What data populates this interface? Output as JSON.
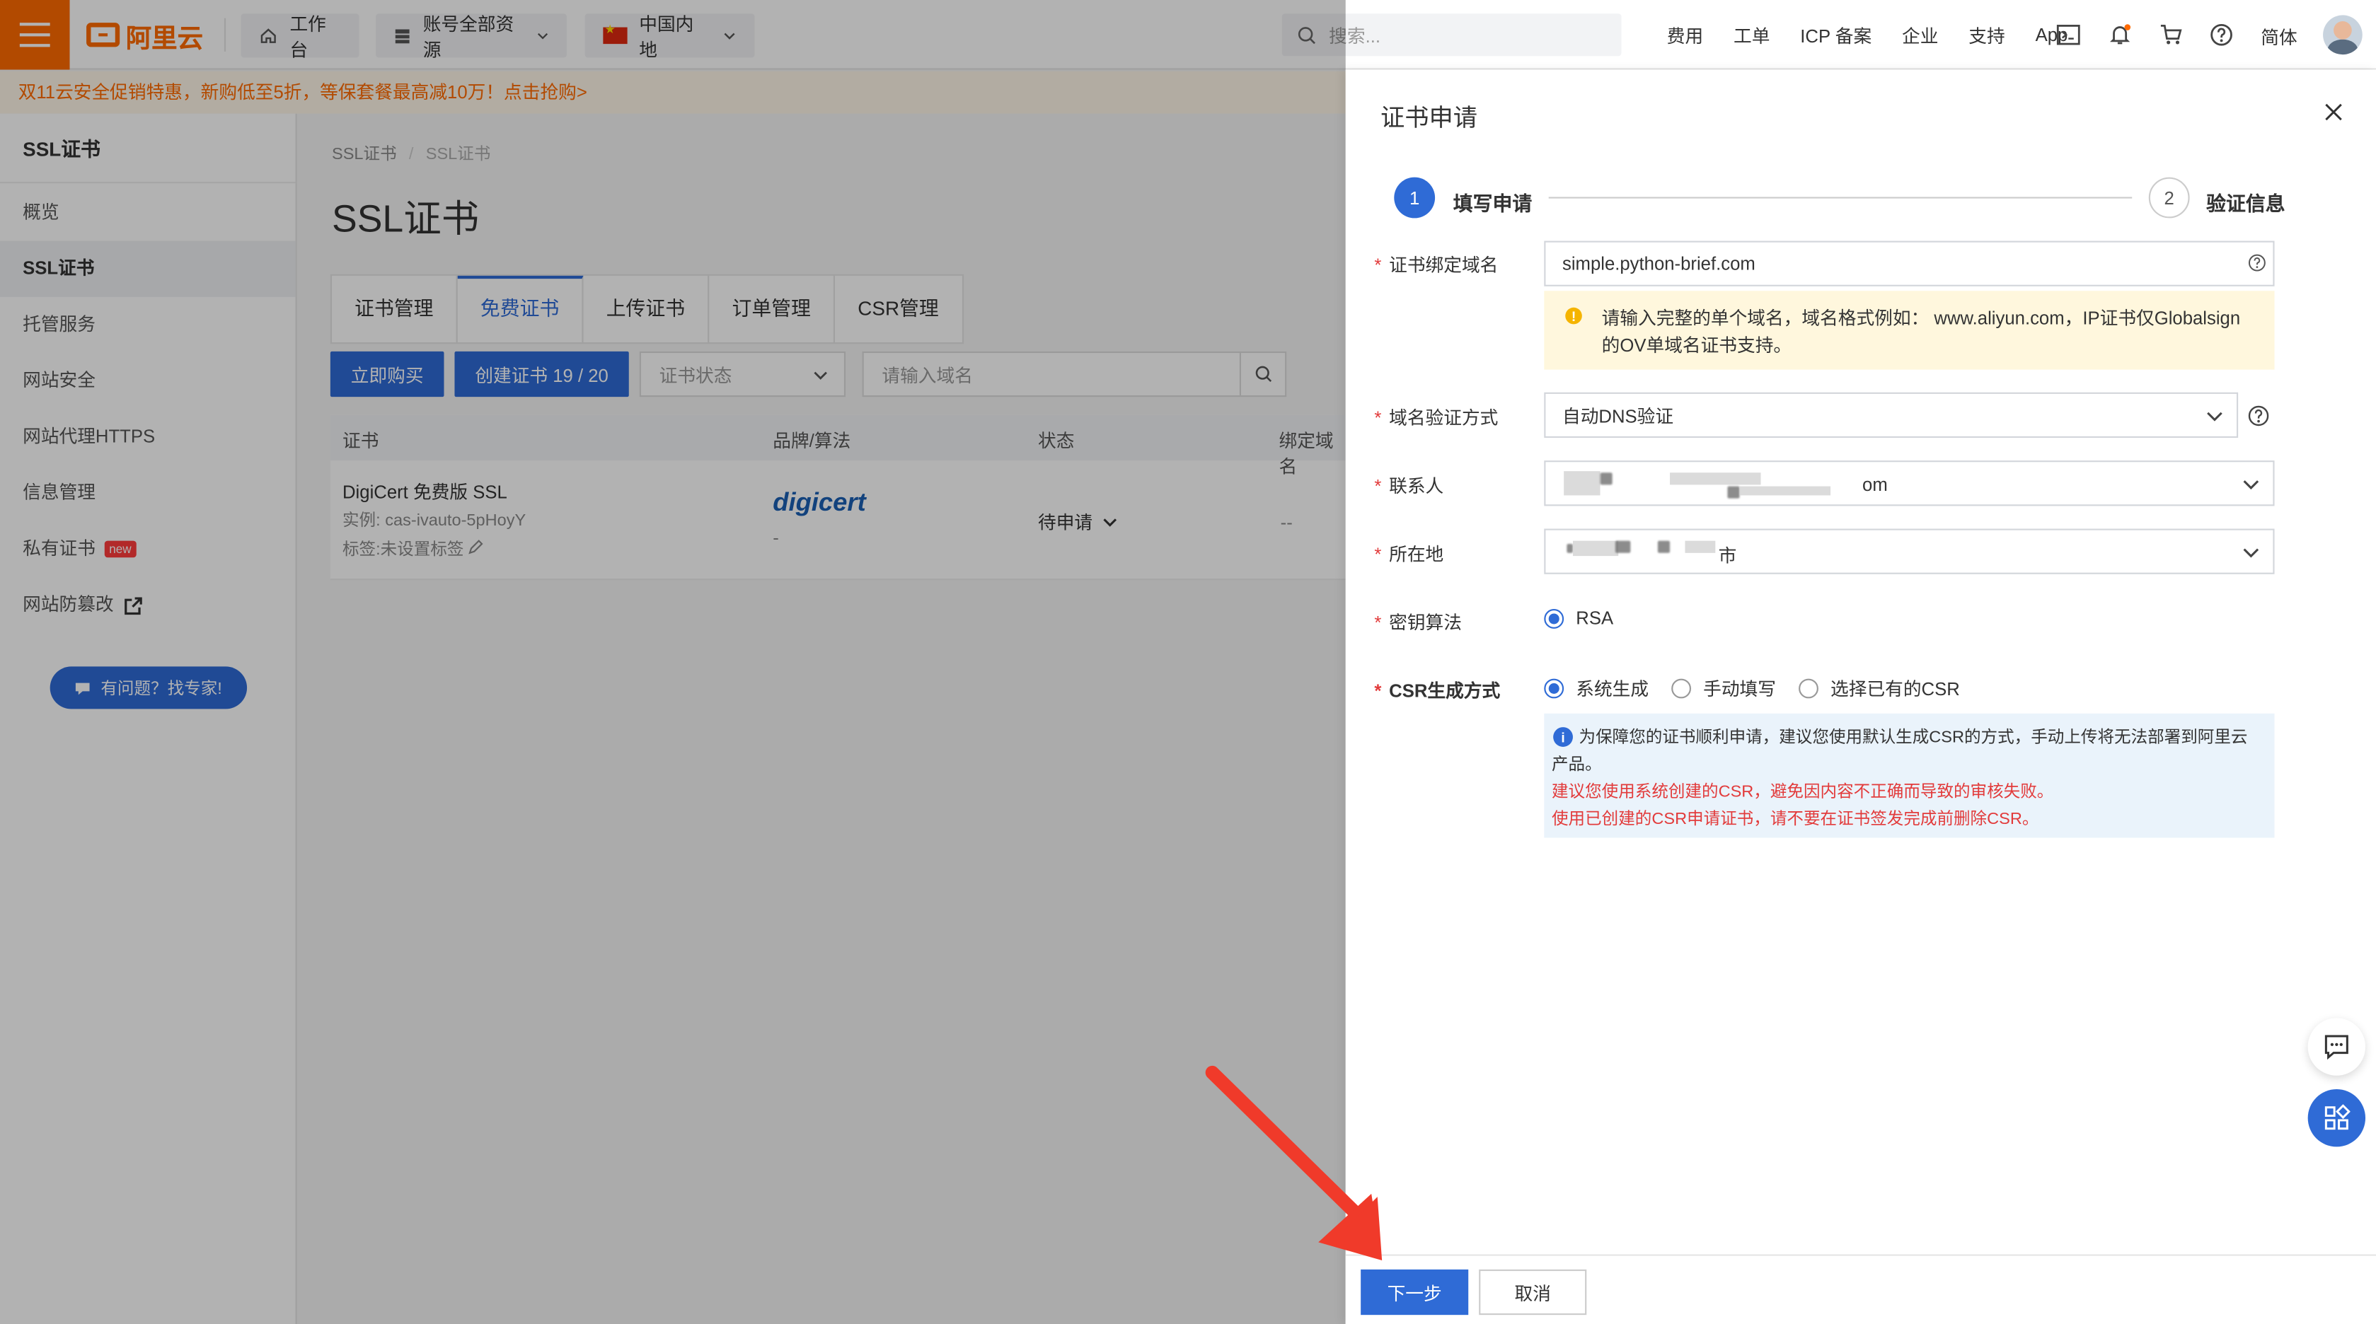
{
  "topbar": {
    "logo_text": "阿里云",
    "workbench": "工作台",
    "account_resources": "账号全部资源",
    "region": "中国内地",
    "search_placeholder": "搜索...",
    "links": [
      "费用",
      "工单",
      "ICP 备案",
      "企业",
      "支持",
      "App"
    ],
    "lang": "简体"
  },
  "promo": {
    "text": "双11云安全促销特惠，新购低至5折，等保套餐最高减10万！点击抢购>"
  },
  "sidebar": {
    "title": "SSL证书",
    "items": [
      {
        "label": "概览"
      },
      {
        "label": "SSL证书"
      },
      {
        "label": "托管服务"
      },
      {
        "label": "网站安全"
      },
      {
        "label": "网站代理HTTPS"
      },
      {
        "label": "信息管理"
      },
      {
        "label": "私有证书",
        "badge": "new"
      },
      {
        "label": "网站防篡改"
      }
    ],
    "expert_button": "有问题？找专家!"
  },
  "main": {
    "breadcrumb": [
      "SSL证书",
      "/",
      "SSL证书"
    ],
    "title": "SSL证书",
    "tabs": [
      "证书管理",
      "免费证书",
      "上传证书",
      "订单管理",
      "CSR管理"
    ],
    "buy_button": "立即购买",
    "create_button": "创建证书 19 / 20",
    "status_select": "证书状态",
    "domain_placeholder": "请输入域名",
    "columns": [
      "证书",
      "品牌/算法",
      "状态",
      "绑定域名"
    ],
    "row": {
      "name": "DigiCert 免费版 SSL",
      "instance": "实例: cas-ivauto-5pHoyY",
      "tag": "标签:未设置标签",
      "brand": "digicert",
      "algo": "-",
      "status": "待申请",
      "domain": "--"
    }
  },
  "drawer": {
    "title": "证书申请",
    "steps": [
      {
        "num": "1",
        "label": "填写申请"
      },
      {
        "num": "2",
        "label": "验证信息"
      }
    ],
    "fields": {
      "domain_label": "证书绑定域名",
      "domain_value": "simple.python-brief.com",
      "domain_hint": "请输入完整的单个域名，域名格式例如： www.aliyun.com，IP证书仅Globalsign的OV单域名证书支持。",
      "verify_label": "域名验证方式",
      "verify_value": "自动DNS验证",
      "contact_label": "联系人",
      "contact_value_suffix": "om",
      "location_label": "所在地",
      "location_value_suffix": "市",
      "key_label": "密钥算法",
      "key_value": "RSA",
      "csr_label": "CSR生成方式",
      "csr_options": [
        "系统生成",
        "手动填写",
        "选择已有的CSR"
      ],
      "csr_info": "为保障您的证书顺利申请，建议您使用默认生成CSR的方式，手动上传将无法部署到阿里云产品。",
      "csr_warn1": "建议您使用系统创建的CSR，避免因内容不正确而导致的审核失败。",
      "csr_warn2": "使用已创建的CSR申请证书，请不要在证书签发完成前删除CSR。"
    },
    "next_button": "下一步",
    "cancel_button": "取消"
  },
  "colors": {
    "brand_orange": "#ff6a00",
    "primary_blue": "#2f6bd6",
    "required_red": "#e23b3b"
  }
}
